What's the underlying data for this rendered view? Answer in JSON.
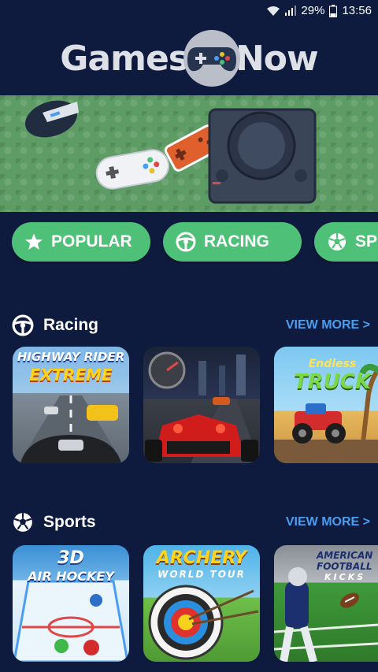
{
  "status_bar": {
    "battery": "29%",
    "time": "13:56"
  },
  "logo": {
    "left_word": "Games",
    "right_word": "Now",
    "icon": "gamepad-icon"
  },
  "categories": [
    {
      "label": "POPULAR",
      "icon": "star-icon"
    },
    {
      "label": "RACING",
      "icon": "steering-wheel-icon"
    },
    {
      "label": "SP",
      "icon": "soccer-ball-icon"
    }
  ],
  "sections": {
    "racing": {
      "title": "Racing",
      "icon": "steering-wheel-icon",
      "view_more": "VIEW MORE >",
      "games": [
        {
          "caption1": "HIGHWAY RIDER",
          "caption2": "EXTREME"
        },
        {
          "caption1": ""
        },
        {
          "caption1": "Endless",
          "caption2": "TRUCK"
        }
      ]
    },
    "sports": {
      "title": "Sports",
      "icon": "soccer-ball-icon",
      "view_more": "VIEW MORE >",
      "games": [
        {
          "caption1": "3D",
          "caption2": "AIR HOCKEY"
        },
        {
          "caption1": "ARCHERY",
          "caption2": "WORLD TOUR"
        },
        {
          "caption1": "AMERICAN",
          "caption2": "FOOTBALL",
          "caption3": "KICKS"
        }
      ]
    }
  },
  "colors": {
    "background": "#0e1b3f",
    "chip": "#4fc077",
    "link": "#4a9df0",
    "hero": "#5e9c66"
  }
}
